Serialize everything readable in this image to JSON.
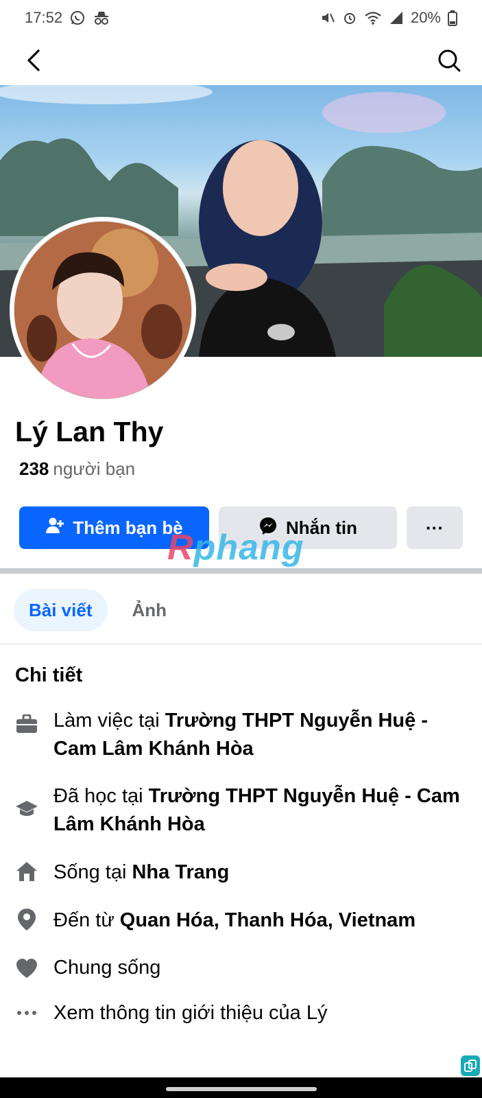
{
  "status_bar": {
    "time": "17:52",
    "battery": "20%",
    "left_icons": [
      "whatsapp-icon",
      "incognito-icon"
    ],
    "right_icons": [
      "mute-icon",
      "alarm-icon",
      "wifi-icon",
      "signal-icon",
      "battery-icon"
    ]
  },
  "app_bar": {
    "back_icon": "back-arrow-icon",
    "search_icon": "search-icon"
  },
  "profile": {
    "name": "Lý Lan Thy",
    "friends_count": "238",
    "friends_label": "người bạn"
  },
  "actions": {
    "add_friend_label": "Thêm bạn bè",
    "message_label": "Nhắn tin",
    "more_label": "···"
  },
  "watermark": {
    "first": "R",
    "rest": "phang"
  },
  "tabs": [
    {
      "label": "Bài viết",
      "active": true
    },
    {
      "label": "Ảnh",
      "active": false
    }
  ],
  "details": {
    "title": "Chi tiết",
    "items": [
      {
        "icon": "briefcase-icon",
        "prefix": "Làm việc tại ",
        "bold": "Trường THPT Nguyễn Huệ - Cam Lâm Khánh Hòa"
      },
      {
        "icon": "graduation-cap-icon",
        "prefix": "Đã học tại ",
        "bold": "Trường THPT Nguyễn Huệ - Cam Lâm Khánh Hòa"
      },
      {
        "icon": "home-icon",
        "prefix": "Sống tại ",
        "bold": "Nha Trang"
      },
      {
        "icon": "location-pin-icon",
        "prefix": "Đến từ ",
        "bold": "Quan Hóa, Thanh Hóa, Vietnam"
      },
      {
        "icon": "heart-icon",
        "prefix": "Chung sống",
        "bold": ""
      },
      {
        "icon": "more-dots-icon",
        "prefix": "Xem thông tin giới thiệu của Lý",
        "bold": ""
      }
    ]
  },
  "colors": {
    "primary": "#0866ff",
    "secondary_bg": "#e4e6eb",
    "muted_text": "#65676b",
    "tab_active_bg": "#ebf5ff"
  }
}
